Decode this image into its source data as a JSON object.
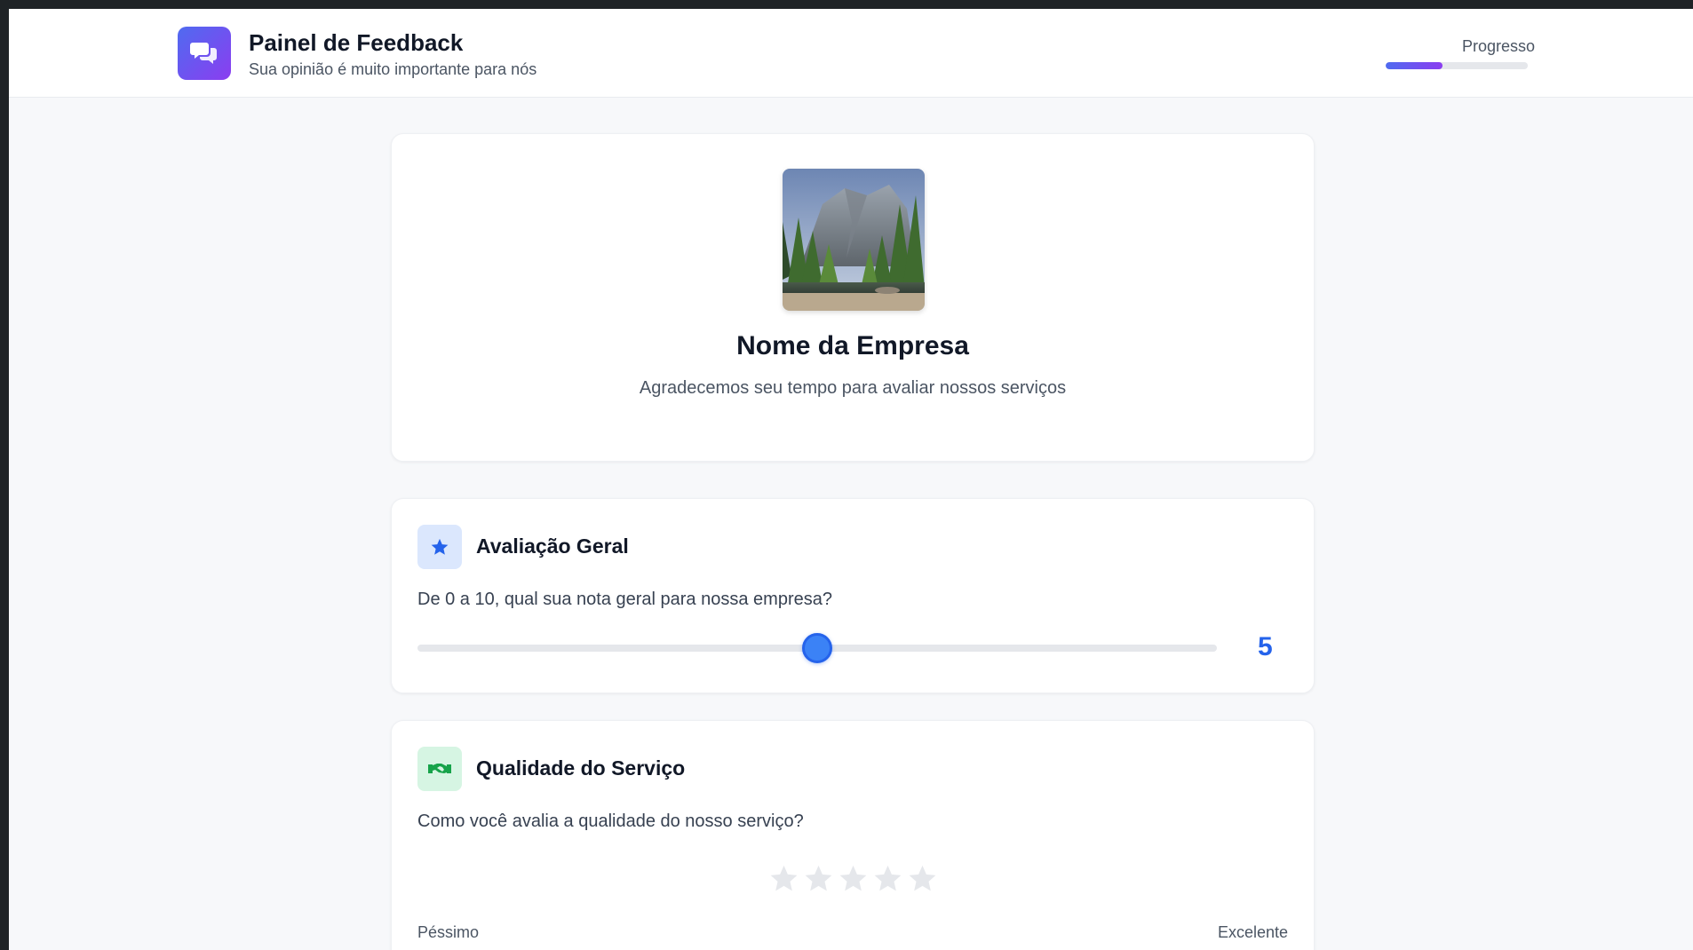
{
  "header": {
    "title": "Painel de Feedback",
    "subtitle": "Sua opinião é muito importante para nós",
    "progress_label": "Progresso",
    "progress_fraction": 0.4
  },
  "company": {
    "name": "Nome da Empresa",
    "tagline": "Agradecemos seu tempo para avaliar nossos serviços",
    "photo_icon": "mountain-landscape-photo"
  },
  "overall": {
    "icon": "star-icon",
    "title": "Avaliação Geral",
    "question": "De 0 a 10, qual sua nota geral para nossa empresa?",
    "min": 0,
    "max": 10,
    "value": 5,
    "value_label": "5"
  },
  "quality": {
    "icon": "handshake-icon",
    "title": "Qualidade do Serviço",
    "question": "Como você avalia a qualidade do nosso serviço?",
    "stars_total": 5,
    "stars_selected": 0,
    "min_label": "Péssimo",
    "max_label": "Excelente"
  },
  "colors": {
    "accent": "#2563eb",
    "brand_gradient_start": "#4f6bf0",
    "brand_gradient_end": "#8b3df0",
    "star_empty": "#e5e7eb"
  }
}
